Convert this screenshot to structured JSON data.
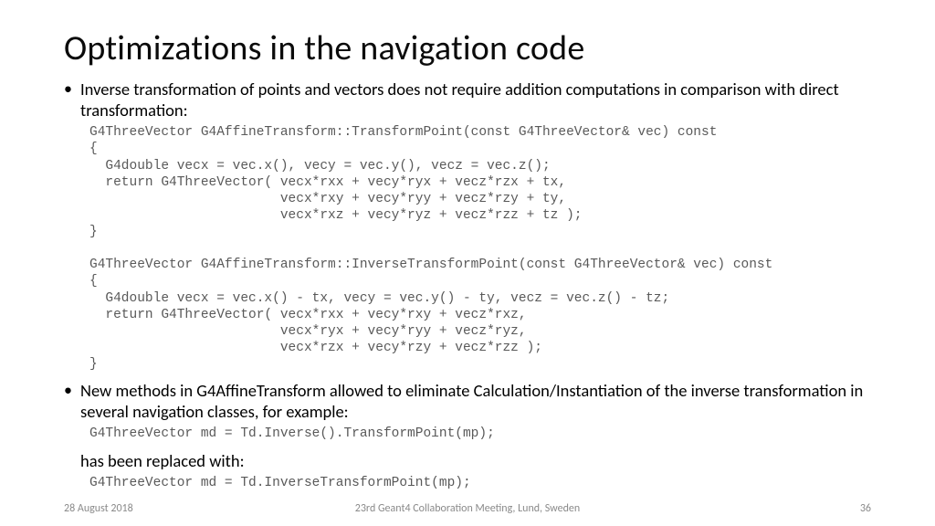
{
  "title": "Optimizations in the navigation code",
  "bullet1": "Inverse transformation of points and vectors does not require addition computations in comparison with direct transformation:",
  "code1": "G4ThreeVector G4AffineTransform::TransformPoint(const G4ThreeVector& vec) const\n{\n  G4double vecx = vec.x(), vecy = vec.y(), vecz = vec.z();\n  return G4ThreeVector( vecx*rxx + vecy*ryx + vecz*rzx + tx,\n                        vecx*rxy + vecy*ryy + vecz*rzy + ty,\n                        vecx*rxz + vecy*ryz + vecz*rzz + tz );\n}\n\nG4ThreeVector G4AffineTransform::InverseTransformPoint(const G4ThreeVector& vec) const\n{\n  G4double vecx = vec.x() - tx, vecy = vec.y() - ty, vecz = vec.z() - tz;\n  return G4ThreeVector( vecx*rxx + vecy*rxy + vecz*rxz,\n                        vecx*ryx + vecy*ryy + vecz*ryz,\n                        vecx*rzx + vecy*rzy + vecz*rzz );\n}",
  "bullet2": "New methods in G4AffineTransform allowed to eliminate Calculation/Instantiation of the inverse transformation in several navigation classes, for example:",
  "code2": "G4ThreeVector md = Td.Inverse().TransformPoint(mp);",
  "replaced": "has been replaced with:",
  "code3": "G4ThreeVector md = Td.InverseTransformPoint(mp);",
  "footer": {
    "date": "28 August 2018",
    "meeting": "23rd Geant4 Collaboration Meeting, Lund, Sweden",
    "page": "36"
  }
}
